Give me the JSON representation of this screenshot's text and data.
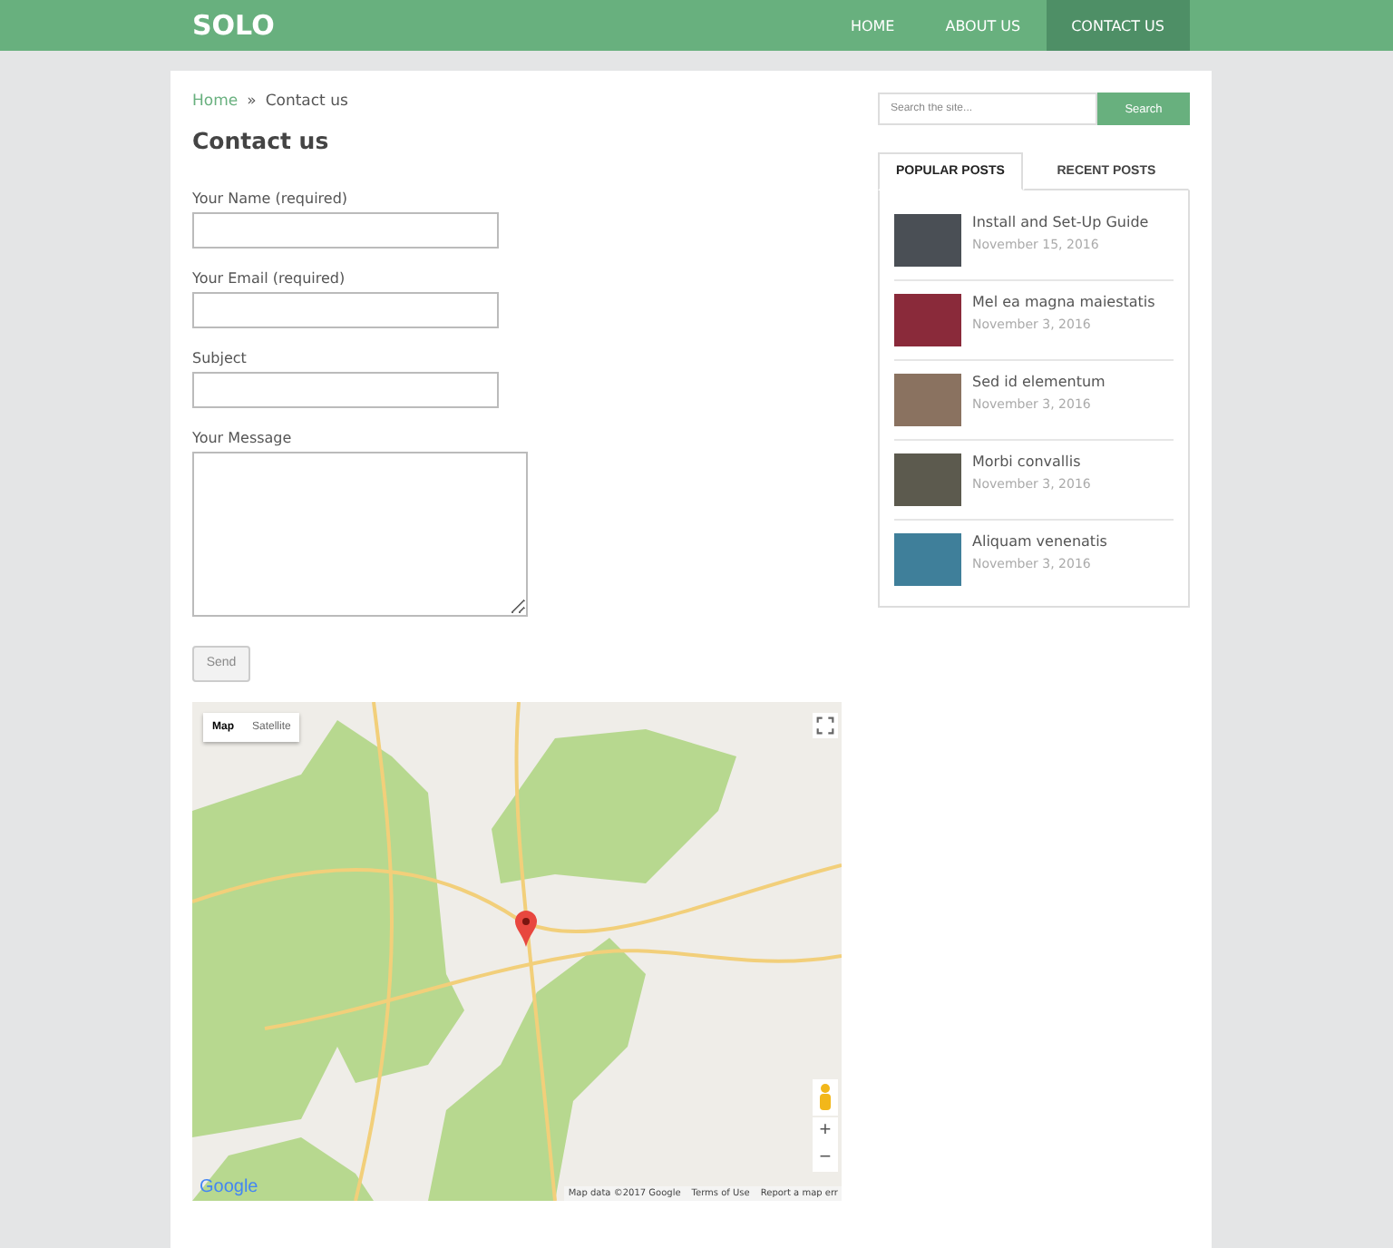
{
  "header": {
    "logo": "SOLO",
    "nav": [
      {
        "label": "HOME",
        "selected": false
      },
      {
        "label": "ABOUT US",
        "selected": false
      },
      {
        "label": "CONTACT US",
        "selected": true
      }
    ]
  },
  "breadcrumb": {
    "links": [
      "Home"
    ],
    "separator": "»",
    "current": "Contact us"
  },
  "page_title": "Contact us",
  "form": {
    "fields": [
      {
        "kind": "input",
        "label": "Your Name (required)"
      },
      {
        "kind": "input",
        "label": "Your Email (required)"
      },
      {
        "kind": "input",
        "label": "Subject"
      },
      {
        "kind": "textarea",
        "label": "Your Message"
      }
    ],
    "submit": "Send"
  },
  "map": {
    "types": [
      {
        "label": "Map",
        "selected": true
      },
      {
        "label": "Satellite",
        "selected": false
      }
    ],
    "zoom_in": "+",
    "zoom_out": "−",
    "logo": "Google",
    "attribution": "Map data ©2017 Google",
    "terms": "Terms of Use",
    "report": "Report a map err"
  },
  "sidebar": {
    "search": {
      "placeholder": "Search the site...",
      "button": "Search"
    },
    "tabs": [
      {
        "label": "POPULAR POSTS",
        "selected": true
      },
      {
        "label": "RECENT POSTS",
        "selected": false
      }
    ],
    "posts": [
      {
        "title": "Install and Set-Up Guide",
        "date": "November 15, 2016"
      },
      {
        "title": "Mel ea magna maiestatis",
        "date": "November 3, 2016"
      },
      {
        "title": "Sed id elementum",
        "date": "November 3, 2016"
      },
      {
        "title": "Morbi convallis",
        "date": "November 3, 2016"
      },
      {
        "title": "Aliquam venenatis",
        "date": "November 3, 2016"
      }
    ]
  }
}
